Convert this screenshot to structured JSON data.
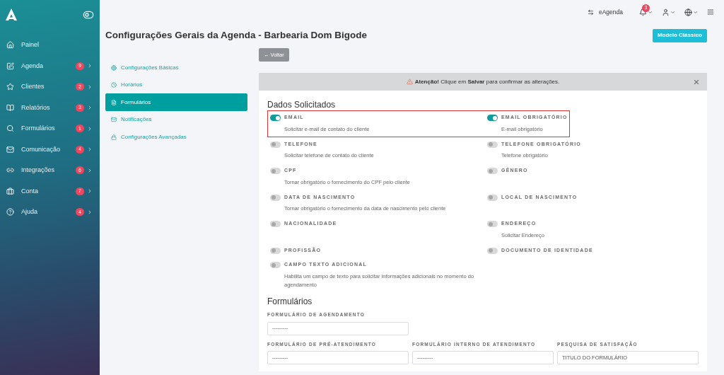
{
  "sidebar": {
    "items": [
      {
        "label": "Painel"
      },
      {
        "label": "Agenda",
        "badge": "9"
      },
      {
        "label": "Clientes",
        "badge": "2"
      },
      {
        "label": "Relatórios",
        "badge": "3"
      },
      {
        "label": "Formulários",
        "badge": "1"
      },
      {
        "label": "Comunicação",
        "badge": "4"
      },
      {
        "label": "Integrações",
        "badge": "6"
      },
      {
        "label": "Conta",
        "badge": "7"
      },
      {
        "label": "Ajuda",
        "badge": "4"
      }
    ]
  },
  "topbar": {
    "switch_label": "eAgenda",
    "notification_count": "3"
  },
  "page": {
    "title": "Configurações Gerais da Agenda - Barbearia Dom Bigode",
    "classic_button": "Modelo Clássico",
    "back_button": "← Voltar"
  },
  "settings_nav": [
    {
      "label": "Configurações Básicas",
      "selected": false
    },
    {
      "label": "Horários",
      "selected": false
    },
    {
      "label": "Formulários",
      "selected": true
    },
    {
      "label": "Notificações",
      "selected": false
    },
    {
      "label": "Configurações Avançadas",
      "selected": false
    }
  ],
  "alert": {
    "text": "**Atenção!** Clique em **Salvar** para confirmar as alterações."
  },
  "requested_data": {
    "title": "Dados Solicitados",
    "rows": [
      {
        "highlighted": true,
        "items": [
          {
            "label": "EMAIL",
            "description": "Solicitar e-mail de contato do cliente",
            "on": true
          },
          {
            "label": "EMAIL OBRIGATÓRIO",
            "description": "E-mail obrigatório",
            "on": true
          }
        ]
      },
      {
        "highlighted": false,
        "items": [
          {
            "label": "TELEFONE",
            "description": "Solicitar telefone de contato do cliente",
            "on": false
          },
          {
            "label": "TELEFONE OBRIGATÓRIO",
            "description": "Telefone obrigatório",
            "on": false
          }
        ]
      },
      {
        "highlighted": false,
        "items": [
          {
            "label": "CPF",
            "description": "Tornar obrigatório o fornecimento do CPF pelo cliente",
            "on": false
          },
          {
            "label": "GÊNERO",
            "on": false
          }
        ]
      },
      {
        "highlighted": false,
        "items": [
          {
            "label": "DATA DE NASCIMENTO",
            "description": "Tornar obrigatório o fornecimento da data de nascimento pelo cliente",
            "on": false
          },
          {
            "label": "LOCAL DE NASCIMENTO",
            "on": false
          }
        ]
      },
      {
        "highlighted": false,
        "items": [
          {
            "label": "NACIONALIDADE",
            "on": false
          },
          {
            "label": "ENDEREÇO",
            "description": "Solicitar Endereço",
            "on": false
          }
        ]
      },
      {
        "highlighted": false,
        "items": [
          {
            "label": "PROFISSÃO",
            "on": false
          },
          {
            "label": "DOCUMENTO DE IDENTIDADE",
            "on": false
          }
        ]
      },
      {
        "highlighted": false,
        "items": [
          {
            "label": "CAMPO TEXTO ADICIONAL",
            "description": "Habilita um campo de texto para solicitar informações adicionais no momento do agendamento",
            "on": false
          }
        ]
      }
    ]
  },
  "forms": {
    "title": "Formulários",
    "rows": [
      [
        {
          "label": "FORMULÁRIO DE AGENDAMENTO",
          "value": "---------"
        }
      ],
      [
        {
          "label": "FORMULÁRIO DE PRÉ-ATENDIMENTO",
          "value": "---------"
        },
        {
          "label": "FORMULÁRIO INTERNO DE ATENDIMENTO",
          "value": "---------"
        },
        {
          "label": "PESQUISA DE SATISFAÇÃO",
          "value": "TITULO DO FORMULÁRIO"
        }
      ]
    ]
  }
}
